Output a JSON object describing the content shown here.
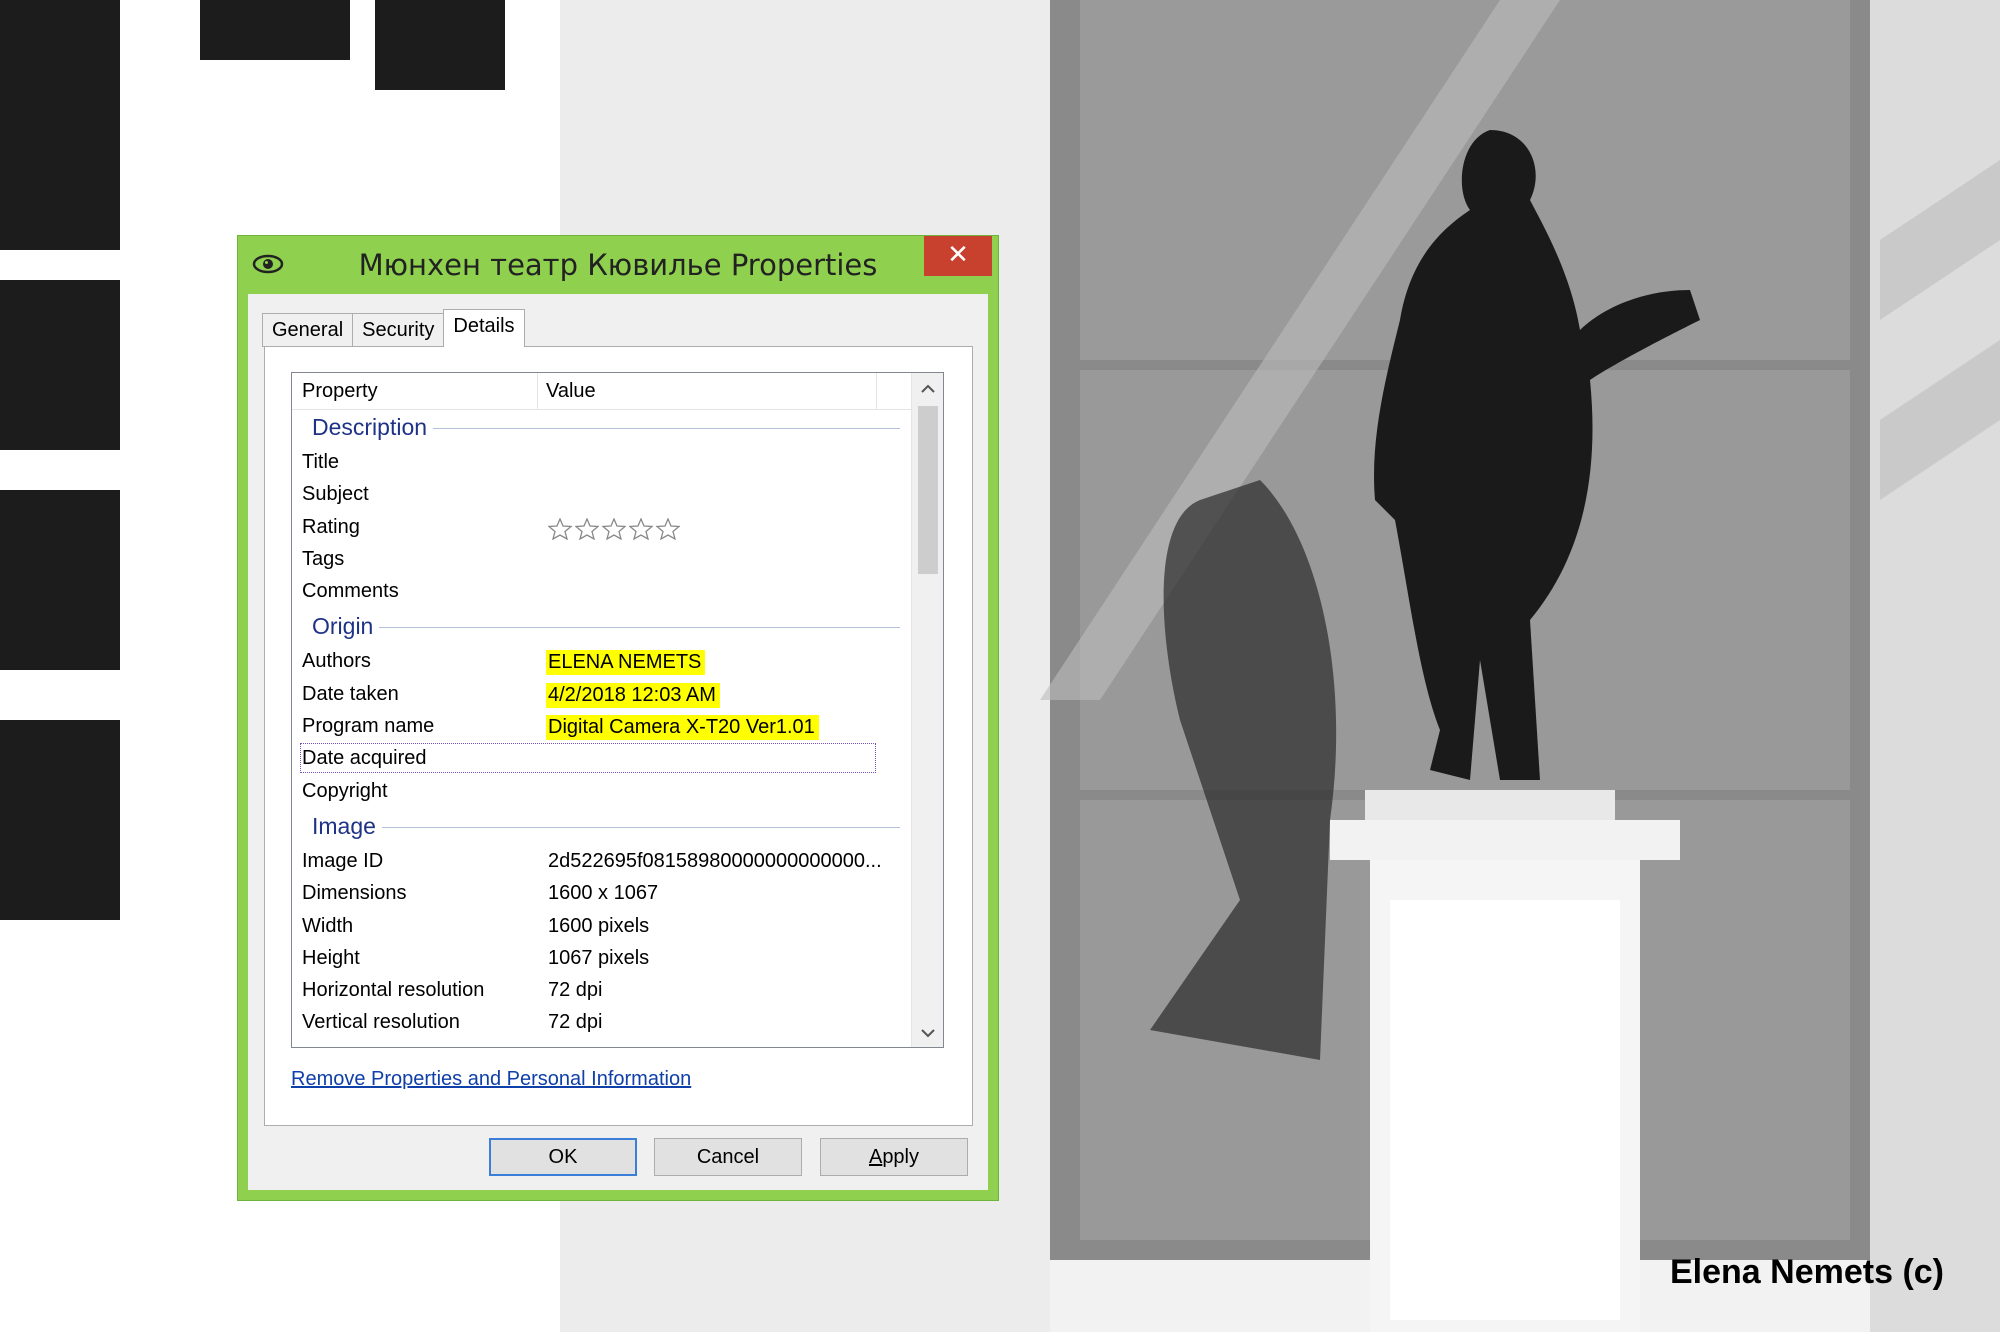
{
  "dialog": {
    "title": "Мюнхен театр Кювилье Properties",
    "close_glyph": "✕",
    "tabs": [
      "General",
      "Security",
      "Details"
    ],
    "active_tab": "Details"
  },
  "list": {
    "header": {
      "property": "Property",
      "value": "Value"
    },
    "groups": {
      "description": {
        "label": "Description",
        "rows": [
          {
            "prop": "Title",
            "value": ""
          },
          {
            "prop": "Subject",
            "value": ""
          },
          {
            "prop": "Rating",
            "value": ""
          },
          {
            "prop": "Tags",
            "value": ""
          },
          {
            "prop": "Comments",
            "value": ""
          }
        ]
      },
      "origin": {
        "label": "Origin",
        "rows": [
          {
            "prop": "Authors",
            "value": "ELENA NEMETS"
          },
          {
            "prop": "Date taken",
            "value": "4/2/2018 12:03 AM"
          },
          {
            "prop": "Program name",
            "value": "Digital Camera X-T20 Ver1.01"
          },
          {
            "prop": "Date acquired",
            "value": ""
          },
          {
            "prop": "Copyright",
            "value": ""
          }
        ]
      },
      "image": {
        "label": "Image",
        "rows": [
          {
            "prop": "Image ID",
            "value": "2d522695f08158980000000000000..."
          },
          {
            "prop": "Dimensions",
            "value": "1600 x 1067"
          },
          {
            "prop": "Width",
            "value": "1600 pixels"
          },
          {
            "prop": "Height",
            "value": "1067 pixels"
          },
          {
            "prop": "Horizontal resolution",
            "value": "72 dpi"
          },
          {
            "prop": "Vertical resolution",
            "value": "72 dpi"
          }
        ]
      }
    },
    "rating_stars": 0,
    "rating_max": 5
  },
  "remove_link": "Remove Properties and Personal Information",
  "buttons": {
    "ok": "OK",
    "cancel": "Cancel",
    "apply_prefix": "A",
    "apply_rest": "pply"
  },
  "highlight_color": "#ffff00",
  "credit": "Elena Nemets (c)"
}
